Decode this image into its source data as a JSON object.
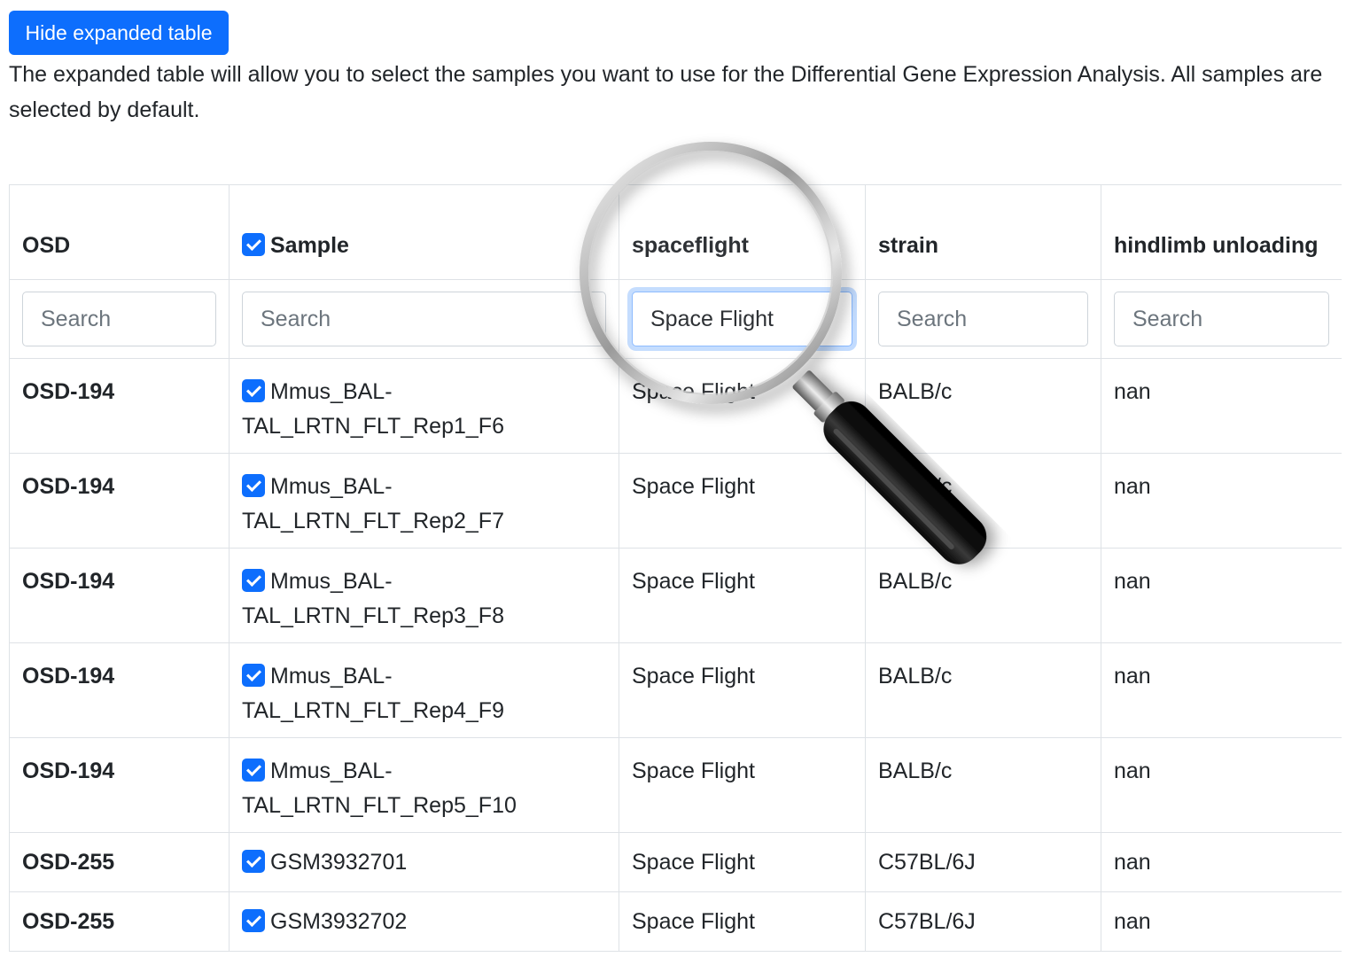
{
  "toolbar": {
    "toggle_label": "Hide expanded table"
  },
  "intro_text": "The expanded table will allow you to select the samples you want to use for the Differential Gene Expression Analysis. All samples are selected by default.",
  "table": {
    "headers": {
      "osd": "OSD",
      "sample": "Sample",
      "spaceflight": "spaceflight",
      "strain": "strain",
      "hindlimb": "hindlimb unloading"
    },
    "filters": {
      "osd_placeholder": "Search",
      "sample_placeholder": "Search",
      "spaceflight_value": "Space Flight",
      "strain_placeholder": "Search",
      "hindlimb_placeholder": "Search"
    },
    "rows": [
      {
        "osd": "OSD-194",
        "sample": "Mmus_BAL-TAL_LRTN_FLT_Rep1_F6",
        "spaceflight": "Space Flight",
        "strain": "BALB/c",
        "hindlimb": "nan",
        "selected": true
      },
      {
        "osd": "OSD-194",
        "sample": "Mmus_BAL-TAL_LRTN_FLT_Rep2_F7",
        "spaceflight": "Space Flight",
        "strain": "BALB/c",
        "hindlimb": "nan",
        "selected": true
      },
      {
        "osd": "OSD-194",
        "sample": "Mmus_BAL-TAL_LRTN_FLT_Rep3_F8",
        "spaceflight": "Space Flight",
        "strain": "BALB/c",
        "hindlimb": "nan",
        "selected": true
      },
      {
        "osd": "OSD-194",
        "sample": "Mmus_BAL-TAL_LRTN_FLT_Rep4_F9",
        "spaceflight": "Space Flight",
        "strain": "BALB/c",
        "hindlimb": "nan",
        "selected": true
      },
      {
        "osd": "OSD-194",
        "sample": "Mmus_BAL-TAL_LRTN_FLT_Rep5_F10",
        "spaceflight": "Space Flight",
        "strain": "BALB/c",
        "hindlimb": "nan",
        "selected": true
      },
      {
        "osd": "OSD-255",
        "sample": "GSM3932701",
        "spaceflight": "Space Flight",
        "strain": "C57BL/6J",
        "hindlimb": "nan",
        "selected": true
      },
      {
        "osd": "OSD-255",
        "sample": "GSM3932702",
        "spaceflight": "Space Flight",
        "strain": "C57BL/6J",
        "hindlimb": "nan",
        "selected": true
      }
    ]
  },
  "overlay": {
    "icon": "magnifying-glass-icon"
  },
  "colors": {
    "accent": "#0d6efd",
    "border": "#dee2e6"
  }
}
